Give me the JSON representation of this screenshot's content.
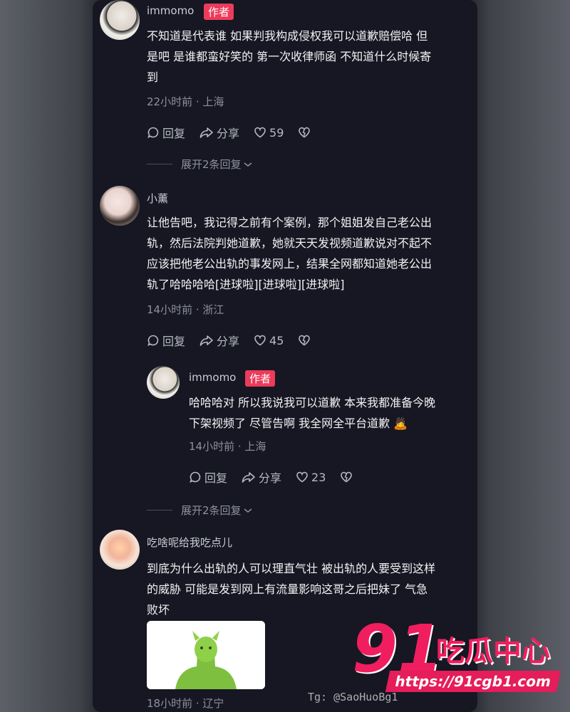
{
  "comments": [
    {
      "user": "immomo",
      "badge": "作者",
      "lines": [
        "不知道是代表谁 如果判我构成侵权我可以道歉赔偿哈 但",
        "是吧 是谁都蛮好笑的 第一次收律师函 不知道什么时候寄",
        "到"
      ],
      "meta": "22小时前 · 上海",
      "reply": "回复",
      "share": "分享",
      "likes": "59"
    },
    {
      "user": "小薰",
      "lines": [
        "让他告吧，我记得之前有个案例，那个姐姐发自己老公出",
        "轨，然后法院判她道歉，她就天天发视频道歉说对不起不",
        "应该把他老公出轨的事发网上，结果全网都知道她老公出",
        "轨了哈哈哈哈[进球啦][进球啦][进球啦]"
      ],
      "meta": "14小时前 · 浙江",
      "reply": "回复",
      "share": "分享",
      "likes": "45"
    },
    {
      "user": "immomo",
      "badge": "作者",
      "lines": [
        "哈哈哈对 所以我说我可以道歉 本来我都准备今晚",
        "下架视频了 尽管告啊 我全网全平台道歉 🙇"
      ],
      "meta": "14小时前 · 上海",
      "reply": "回复",
      "share": "分享",
      "likes": "23"
    },
    {
      "user": "吃啥呢给我吃点儿",
      "lines": [
        "到底为什么出轨的人可以理直气壮 被出轨的人要受到这样",
        "的威胁 可能是发到网上有流量影响这哥之后把妹了 气急",
        "败坏"
      ],
      "meta": "18小时前 · 辽宁"
    }
  ],
  "expand1": "展开2条回复",
  "expand2": "展开2条回复",
  "watermark": {
    "number": "91",
    "text": "吃瓜中心",
    "url": "https://91cgb1.com",
    "tg": "Tg: @SaoHuoBg1"
  },
  "colors": {
    "panel_bg": "#161722",
    "badge": "#ec3b5b",
    "watermark": "#f01e5e"
  }
}
